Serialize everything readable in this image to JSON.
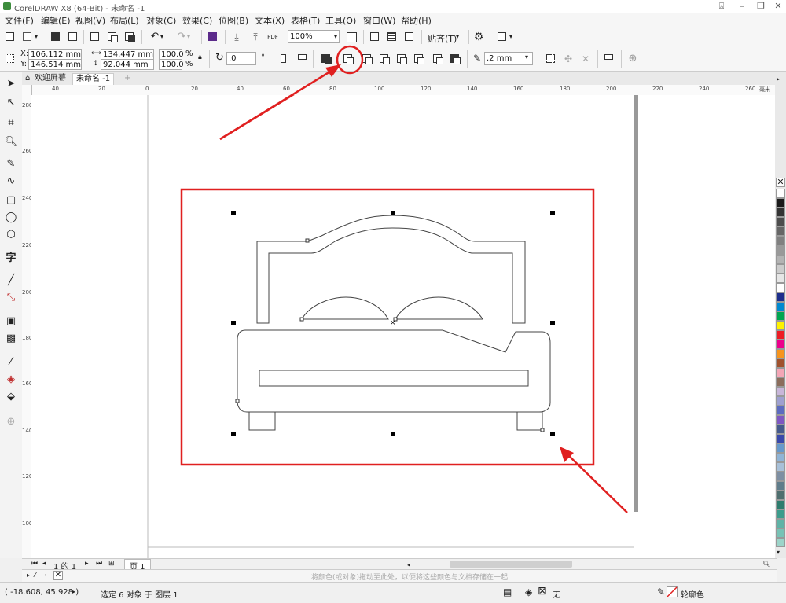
{
  "window": {
    "title": "CorelDRAW X8 (64-Bit) - 未命名 -1"
  },
  "menu": [
    "文件(F)",
    "编辑(E)",
    "视图(V)",
    "布局(L)",
    "对象(C)",
    "效果(C)",
    "位图(B)",
    "文本(X)",
    "表格(T)",
    "工具(O)",
    "窗口(W)",
    "帮助(H)"
  ],
  "std_toolbar": {
    "zoom": "100%",
    "snap_label": "贴齐(T)"
  },
  "props": {
    "x": "106.112 mm",
    "y": "146.514 mm",
    "width": "134.447 mm",
    "height": "92.044 mm",
    "scale_x": "100.0",
    "scale_y": "100.0",
    "percent": "%",
    "rotation": ".0",
    "outline_width": ".2 mm",
    "x_label": "X:",
    "y_label": "Y:"
  },
  "tabs": {
    "welcome": "欢迎屏幕",
    "doc": "未命名 -1"
  },
  "hruler": [
    "40",
    "20",
    "0",
    "20",
    "40",
    "60",
    "80",
    "100",
    "120",
    "140",
    "160",
    "180",
    "200",
    "220",
    "240",
    "260",
    "毫米"
  ],
  "vruler": [
    "280",
    "260",
    "240",
    "220",
    "200",
    "180",
    "160",
    "140",
    "120",
    "100"
  ],
  "page_nav": {
    "position": "1 的 1",
    "page_tab": "页 1"
  },
  "docpal_hint": "将颜色(或对象)拖动至此处，以便将这些颜色与文档存储在一起",
  "status": {
    "coords": "( -18.608, 45.928 )",
    "selection": "选定 6 对象 于 图层 1",
    "fill": "无",
    "outline": "轮廓色"
  },
  "colors": {
    "annotation_red": "#e02020",
    "palette": [
      "#ffffff",
      "#1a1a1a",
      "#333333",
      "#4d4d4d",
      "#666666",
      "#808080",
      "#999999",
      "#b3b3b3",
      "#cccccc",
      "#e6e6e6",
      "#ffffff",
      "#1d2e8c",
      "#0089d0",
      "#00a650",
      "#fff200",
      "#ed1c24",
      "#ec008c",
      "#f7941d",
      "#a0522d",
      "#f4a6b6",
      "#8b6d5c",
      "#c8b6d9",
      "#9ea0d0",
      "#5c6bc0",
      "#7e57c2",
      "#455a8c",
      "#3949ab",
      "#6699cc",
      "#90b4d6",
      "#a8c0d8",
      "#7e8fa3",
      "#607d8b",
      "#4f6f6f",
      "#2e7d6e",
      "#3c9c8c",
      "#5fb3a6",
      "#78c2b5",
      "#9cd4c9",
      "#b2dfdb",
      "#cfe8e4"
    ]
  }
}
